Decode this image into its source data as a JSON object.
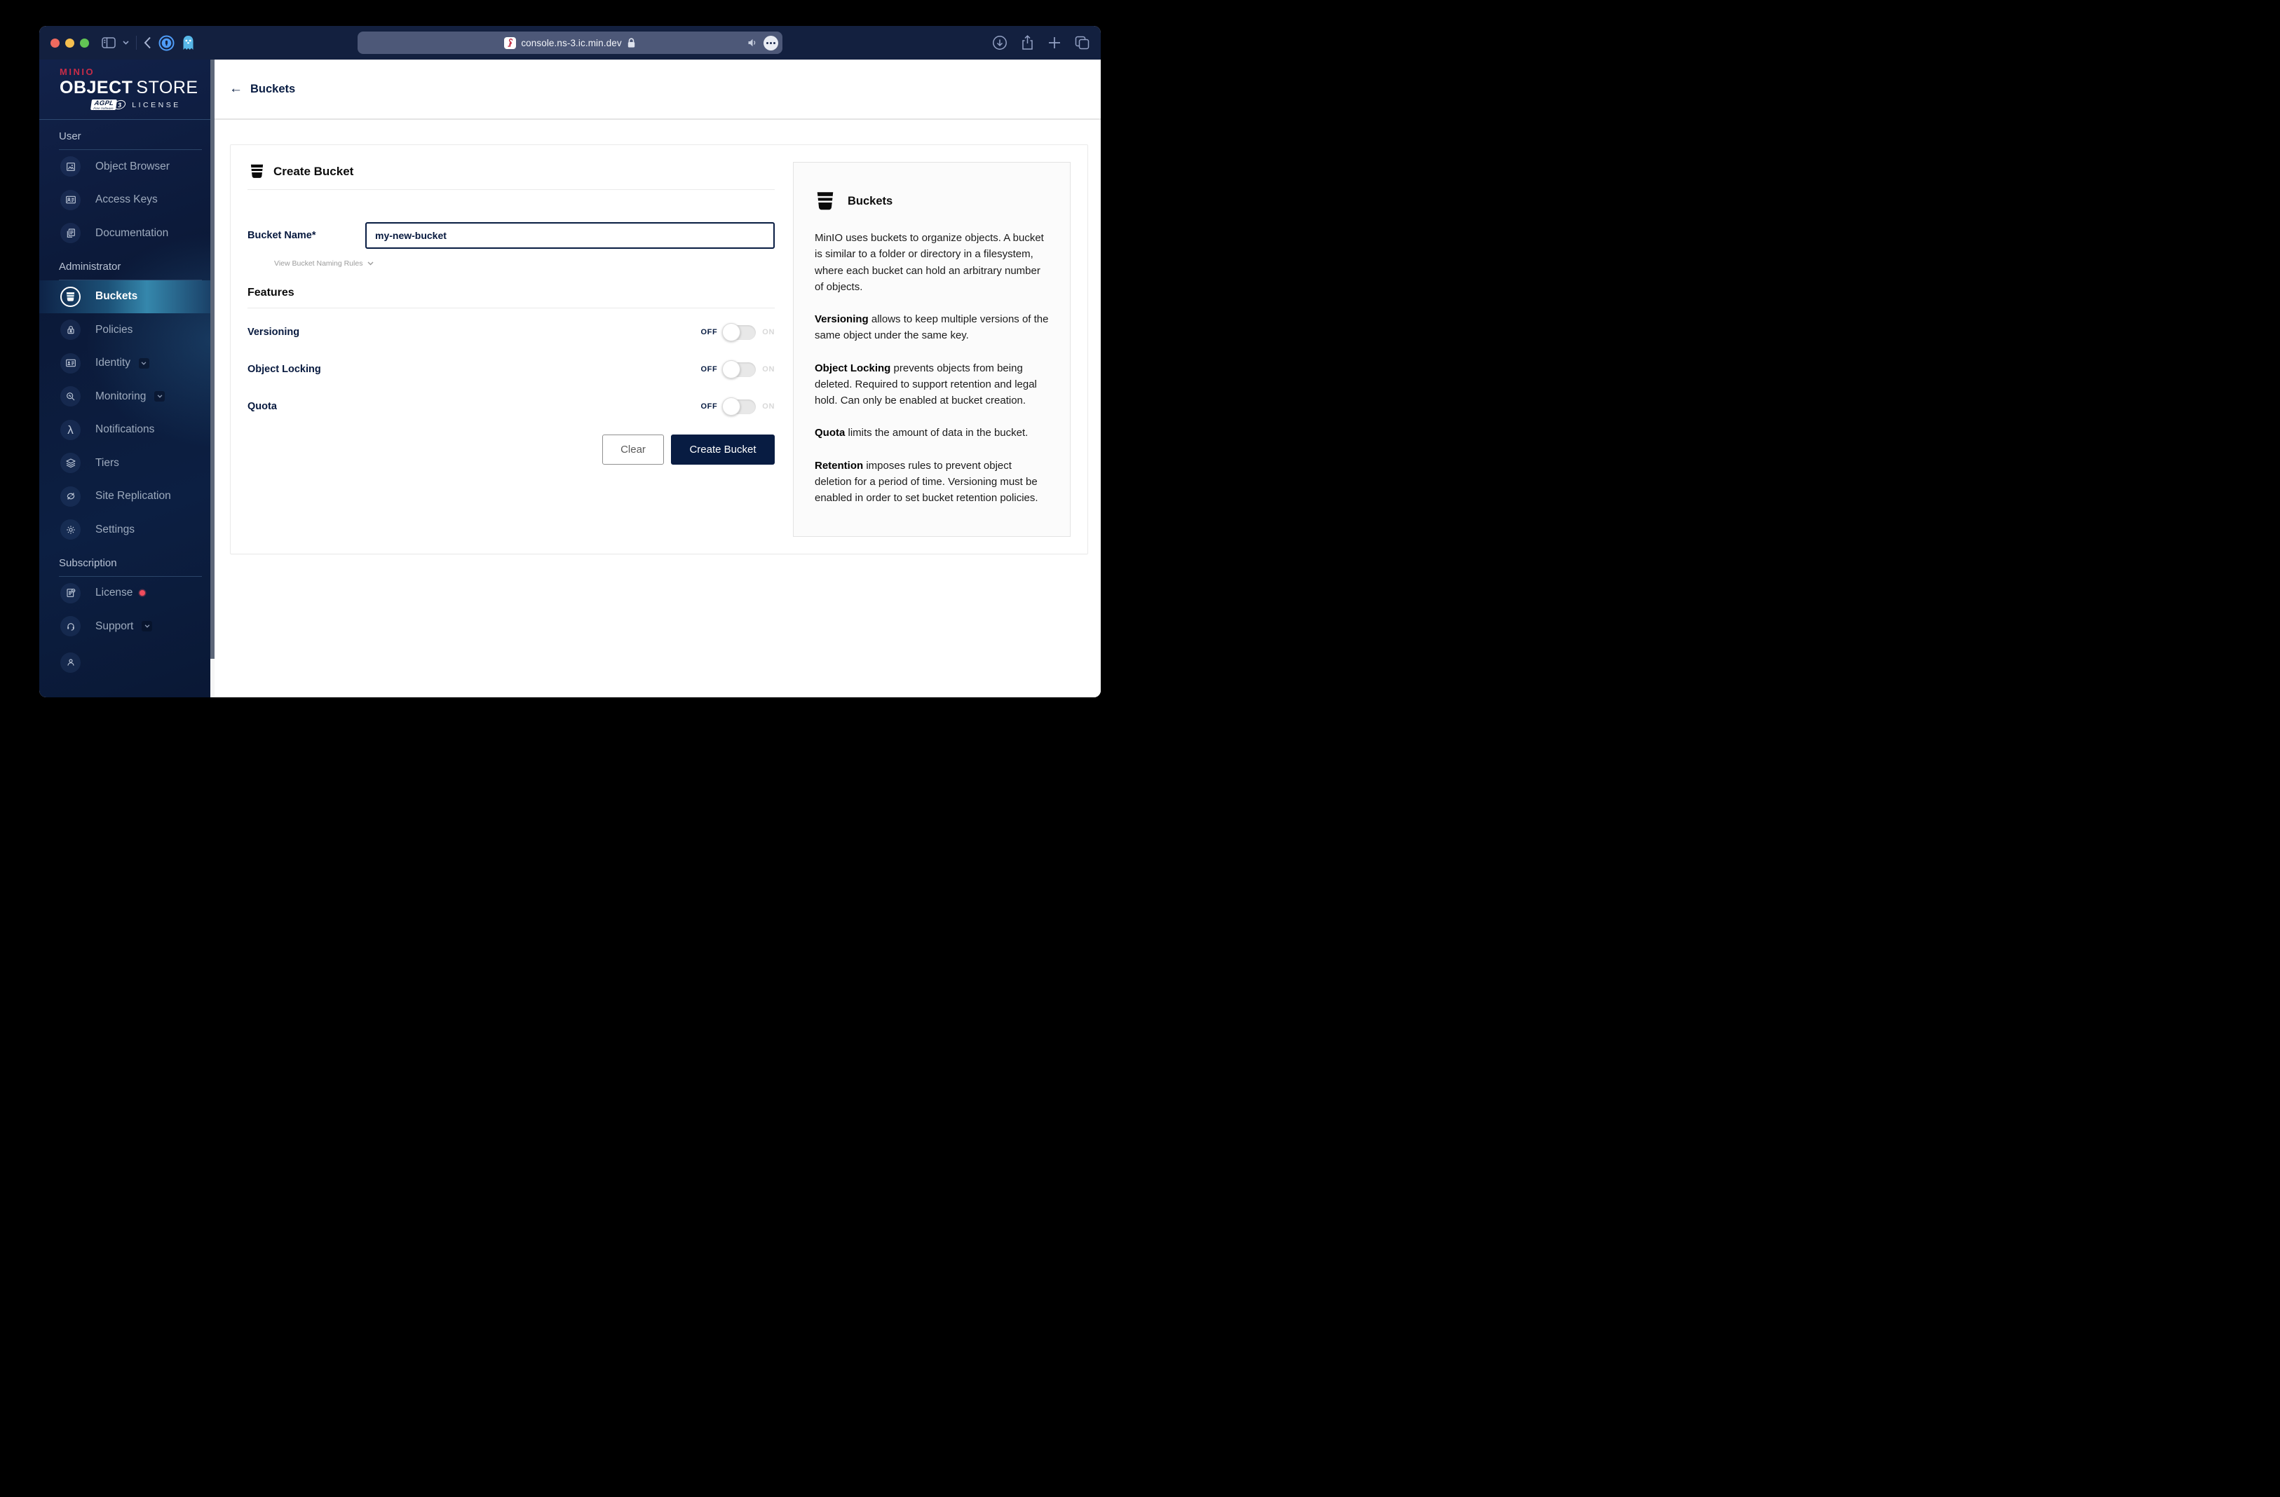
{
  "browser": {
    "url": "console.ns-3.ic.min.dev"
  },
  "sidebar": {
    "logo": {
      "brand": "MINIO",
      "title_strong": "OBJECT",
      "title_light": "STORE",
      "badge": "AGPL",
      "badge_sub": "Free Software",
      "badge_version": "3",
      "license": "LICENSE"
    },
    "sections": [
      {
        "label": "User",
        "items": [
          {
            "label": "Object Browser"
          },
          {
            "label": "Access Keys"
          },
          {
            "label": "Documentation"
          }
        ]
      },
      {
        "label": "Administrator",
        "items": [
          {
            "label": "Buckets",
            "selected": true
          },
          {
            "label": "Policies"
          },
          {
            "label": "Identity",
            "chevron": true
          },
          {
            "label": "Monitoring",
            "chevron": true
          },
          {
            "label": "Notifications"
          },
          {
            "label": "Tiers"
          },
          {
            "label": "Site Replication"
          },
          {
            "label": "Settings"
          }
        ]
      },
      {
        "label": "Subscription",
        "items": [
          {
            "label": "License",
            "alert_dot": true
          },
          {
            "label": "Support",
            "chevron": true
          }
        ]
      }
    ]
  },
  "header": {
    "back_label": "Buckets"
  },
  "form": {
    "title": "Create Bucket",
    "bucket_name_label": "Bucket Name*",
    "bucket_name_value": "my-new-bucket",
    "naming_rules_label": "View Bucket Naming Rules",
    "features_title": "Features",
    "off_label": "OFF",
    "on_label": "ON",
    "toggles": [
      {
        "label": "Versioning",
        "state": "OFF"
      },
      {
        "label": "Object Locking",
        "state": "OFF"
      },
      {
        "label": "Quota",
        "state": "OFF"
      }
    ],
    "clear_button": "Clear",
    "create_button": "Create Bucket"
  },
  "help": {
    "title": "Buckets",
    "paragraphs": [
      {
        "lead": "",
        "text": "MinIO uses buckets to organize objects. A bucket is similar to a folder or directory in a filesystem, where each bucket can hold an arbitrary number of objects."
      },
      {
        "lead": "Versioning",
        "text": " allows to keep multiple versions of the same object under the same key."
      },
      {
        "lead": "Object Locking",
        "text": " prevents objects from being deleted. Required to support retention and legal hold. Can only be enabled at bucket creation."
      },
      {
        "lead": "Quota",
        "text": " limits the amount of data in the bucket."
      },
      {
        "lead": "Retention",
        "text": " imposes rules to prevent object deletion for a period of time. Versioning must be enabled in order to set bucket retention policies."
      }
    ]
  },
  "colors": {
    "accent_navy": "#081C42",
    "brand_red": "#C72C48",
    "selected_glow": "#3587AC",
    "license_dot": "#F14C5D"
  }
}
